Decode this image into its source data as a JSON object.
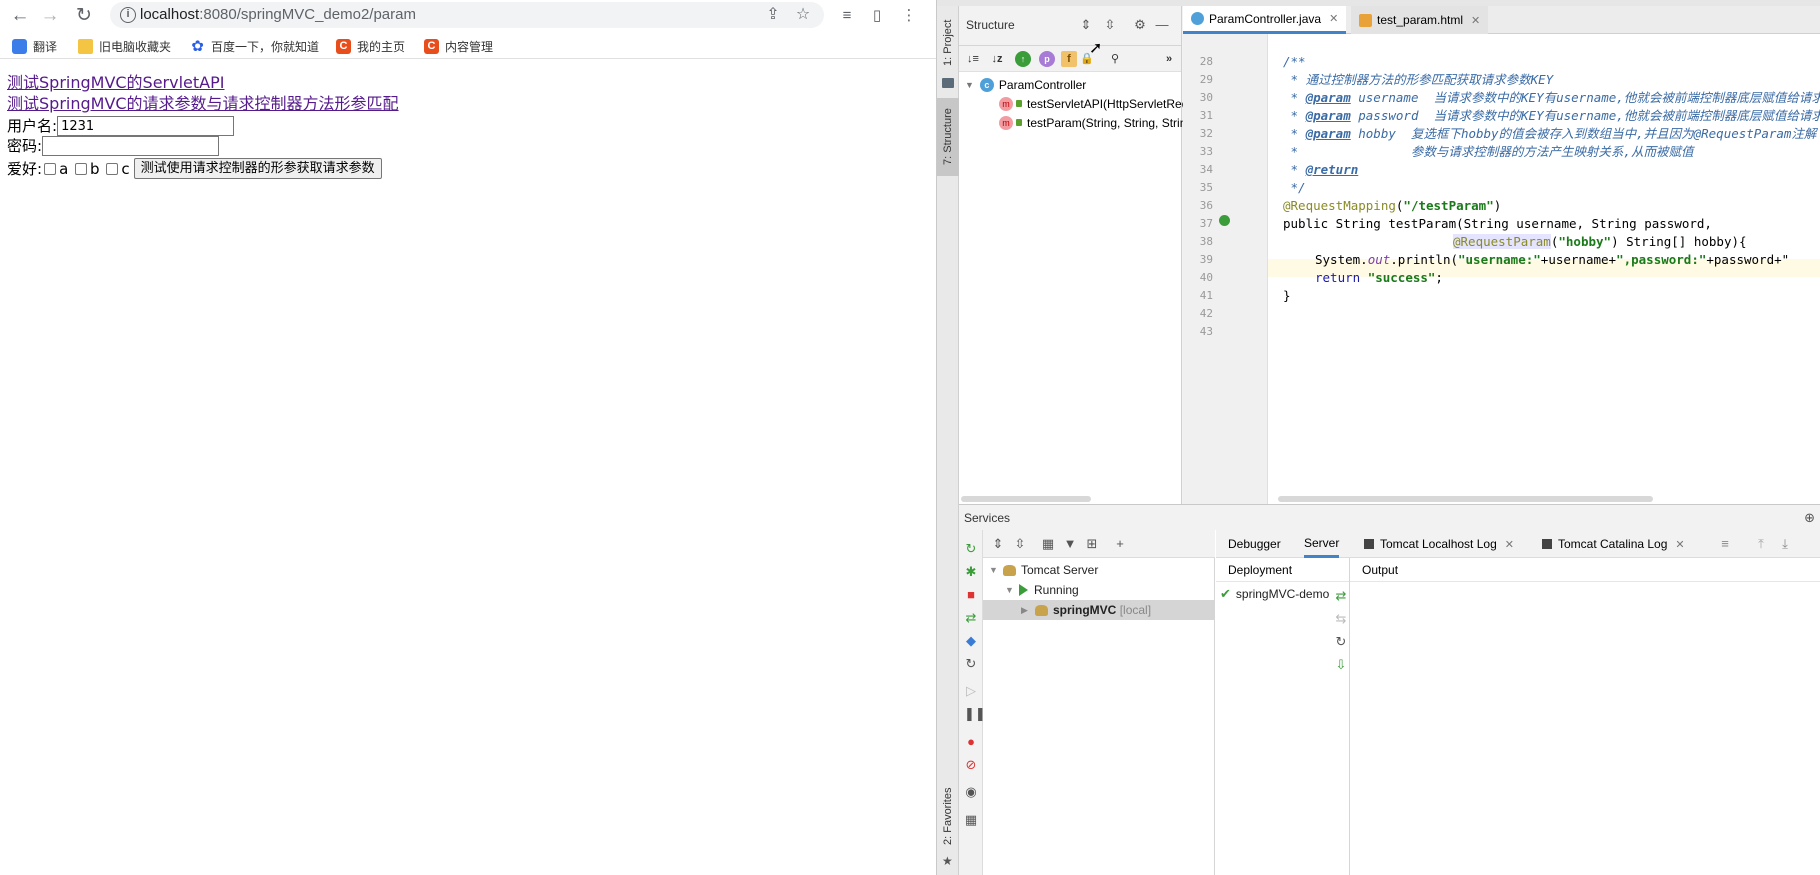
{
  "browser": {
    "url_host": "localhost",
    "url_path": ":8080/springMVC_demo2/param",
    "bookmarks": [
      {
        "label": "翻译",
        "icon": "translate-icon"
      },
      {
        "label": "旧电脑收藏夹",
        "icon": "folder-icon"
      },
      {
        "label": "百度一下，你就知道",
        "icon": "baidu-icon"
      },
      {
        "label": "我的主页",
        "icon": "csdn-icon"
      },
      {
        "label": "内容管理",
        "icon": "csdn-icon"
      }
    ],
    "page": {
      "link1": "测试SpringMVC的ServletAPI",
      "link2": "测试SpringMVC的请求参数与请求控制器方法形参匹配",
      "username_label": "用户名:",
      "username_value": "1231",
      "password_label": "密码:",
      "password_value": "",
      "hobby_label": "爱好:",
      "hobby_options": [
        "a",
        "b",
        "c"
      ],
      "submit_label": "测试使用请求控制器的形参获取请求参数"
    }
  },
  "ide": {
    "left_strip": {
      "project": "1: Project",
      "structure": "7: Structure",
      "favorites": "2: Favorites"
    },
    "structure": {
      "title": "Structure",
      "root": "ParamController",
      "methods": [
        "testServletAPI(HttpServletRequest)",
        "testParam(String, String, String[])"
      ]
    },
    "tabs": [
      {
        "label": "ParamController.java",
        "active": true
      },
      {
        "label": "test_param.html",
        "active": false
      }
    ],
    "line_numbers": [
      "28",
      "29",
      "30",
      "31",
      "32",
      "33",
      "34",
      "35",
      "36",
      "37",
      "38",
      "39",
      "40",
      "41",
      "42",
      "43"
    ],
    "code": {
      "l28": "/**",
      "l29": " * 通过控制器方法的形参匹配获取请求参数KEY",
      "l30_tag": "@param",
      "l30_rest": " username  当请求参数中的KEY有username,他就会被前端控制器底层赋值给请求参数",
      "l31_tag": "@param",
      "l31_rest": " password  当请求参数中的KEY有username,他就会被前端控制器底层赋值给请求参数",
      "l32_tag": "@param",
      "l32_rest": " hobby  复选框下hobby的值会被存入到数组当中,并且因为@RequestParam注解",
      "l33": " *               参数与请求控制器的方法产生映射关系,从而被赋值",
      "l34_tag": "@return",
      "l35": " */",
      "l36_ann": "@RequestMapping",
      "l36_str": "\"/testParam\"",
      "l37": "public String testParam(String username, String password,",
      "l38_ann": "@RequestParam",
      "l38_str": "\"hobby\"",
      "l38_rest": " String[] hobby){",
      "l39_a": "System.",
      "l39_out": "out",
      "l39_b": ".println(",
      "l39_s1": "\"username:\"",
      "l39_c": "+username+",
      "l39_s2": "\",password:\"",
      "l39_d": "+password+\"",
      "l40_kw": "return",
      "l40_str": "\"success\"",
      "l41": "}"
    },
    "services": {
      "title": "Services",
      "tree": {
        "server": "Tomcat Server",
        "status": "Running",
        "app": "springMVC",
        "app_suffix": "[local]"
      },
      "tabs": [
        "Debugger",
        "Server",
        "Tomcat Localhost Log",
        "Tomcat Catalina Log"
      ],
      "deployment_header": "Deployment",
      "output_header": "Output",
      "deployment_item": "springMVC-demo"
    }
  }
}
